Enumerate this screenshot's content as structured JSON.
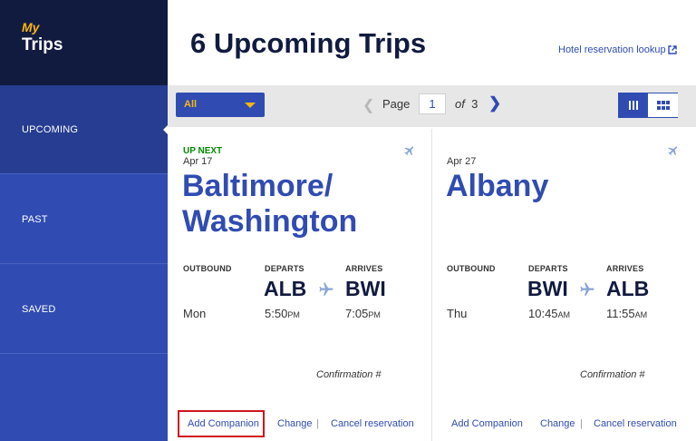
{
  "sidebar": {
    "brand_my": "My",
    "brand_trips": "Trips",
    "items": [
      {
        "label": "UPCOMING",
        "active": true
      },
      {
        "label": "PAST",
        "active": false
      },
      {
        "label": "SAVED",
        "active": false
      }
    ]
  },
  "header": {
    "title": "6 Upcoming Trips",
    "hotel_link": "Hotel reservation lookup",
    "hotel_link_icon": "external-link-icon"
  },
  "toolbar": {
    "filter": {
      "selected": "All",
      "icon": "chevron-down-icon"
    },
    "pagination": {
      "prev_icon": "chevron-left-icon",
      "page_label": "Page",
      "current": "1",
      "of_label": "of",
      "total": "3",
      "next_icon": "chevron-right-icon"
    },
    "views": [
      {
        "name": "list-view",
        "active": true
      },
      {
        "name": "grid-view",
        "active": false
      }
    ]
  },
  "trips": [
    {
      "badge": "UP NEXT",
      "date": "Apr 17",
      "city_line1": "Baltimore/",
      "city_line2": "Washington",
      "outbound_label": "OUTBOUND",
      "departs_label": "DEPARTS",
      "arrives_label": "ARRIVES",
      "from": "ALB",
      "to": "BWI",
      "day": "Mon",
      "depart_time": "5:50",
      "depart_ampm": "PM",
      "arrive_time": "7:05",
      "arrive_ampm": "PM",
      "confirmation_label": "Confirmation #",
      "actions": {
        "add_companion": "Add Companion",
        "change": "Change",
        "sep": "|",
        "cancel": "Cancel reservation"
      }
    },
    {
      "badge": "",
      "date": "Apr 27",
      "city_line1": "Albany",
      "city_line2": "",
      "outbound_label": "OUTBOUND",
      "departs_label": "DEPARTS",
      "arrives_label": "ARRIVES",
      "from": "BWI",
      "to": "ALB",
      "day": "Thu",
      "depart_time": "10:45",
      "depart_ampm": "AM",
      "arrive_time": "11:55",
      "arrive_ampm": "AM",
      "confirmation_label": "Confirmation #",
      "actions": {
        "add_companion": "Add Companion",
        "change": "Change",
        "sep": "|",
        "cancel": "Cancel reservation"
      }
    }
  ],
  "colors": {
    "navy": "#111b40",
    "blue": "#304cb2",
    "gold": "#f9b612",
    "green": "#008a00",
    "highlight": "#d0161b"
  }
}
